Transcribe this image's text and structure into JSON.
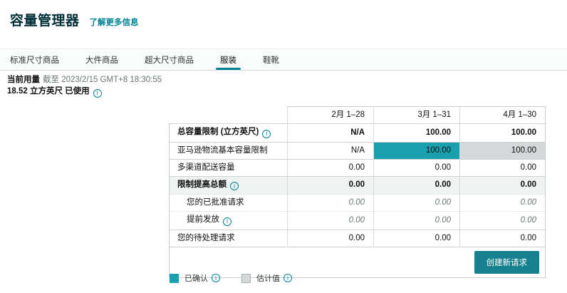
{
  "page": {
    "title": "容量管理器",
    "learn_more_label": "了解更多信息"
  },
  "tabs": [
    {
      "label": "标准尺寸商品",
      "selected": false
    },
    {
      "label": "大件商品",
      "selected": false
    },
    {
      "label": "超大尺寸商品",
      "selected": false
    },
    {
      "label": "服装",
      "selected": true
    },
    {
      "label": "鞋靴",
      "selected": false
    }
  ],
  "usage": {
    "label": "当前用量",
    "as_of": "截至 2023/2/15 GMT+8 18:30:55",
    "amount": "18.52 立方英尺 已使用"
  },
  "table": {
    "columns": [
      "2月 1–28",
      "3月 1–31",
      "4月 1–30"
    ],
    "rows": [
      {
        "label": "总容量限制 (立方英尺)",
        "has_info": true,
        "values": [
          "N/A",
          "100.00",
          "100.00"
        ]
      },
      {
        "label": "亚马逊物流基本容量限制",
        "has_info": false,
        "values": [
          "N/A",
          "100.00",
          "100.00"
        ],
        "cell_states": [
          "none",
          "confirmed",
          "estimated"
        ]
      },
      {
        "label": "多渠道配送容量",
        "has_info": false,
        "values": [
          "0.00",
          "0.00",
          "0.00"
        ]
      },
      {
        "label": "限制提高总额",
        "has_info": true,
        "values": [
          "0.00",
          "0.00",
          "0.00"
        ]
      },
      {
        "label": "您的已批准请求",
        "has_info": false,
        "values": [
          "0.00",
          "0.00",
          "0.00"
        ]
      },
      {
        "label": "提前发放",
        "has_info": true,
        "values": [
          "0.00",
          "0.00",
          "0.00"
        ]
      },
      {
        "label": "您的待处理请求",
        "has_info": false,
        "values": [
          "0.00",
          "0.00",
          "0.00"
        ]
      }
    ],
    "action_button_label": "创建新请求"
  },
  "legend": [
    {
      "label": "已确认",
      "state": "confirmed"
    },
    {
      "label": "估计值",
      "state": "estimated"
    }
  ],
  "colors": {
    "accent_teal": "#008296",
    "confirmed_cell": "#1a9fae",
    "estimated_cell": "#d5d8d8",
    "button_teal": "#17808f",
    "shaded_row": "#eef2f0"
  }
}
